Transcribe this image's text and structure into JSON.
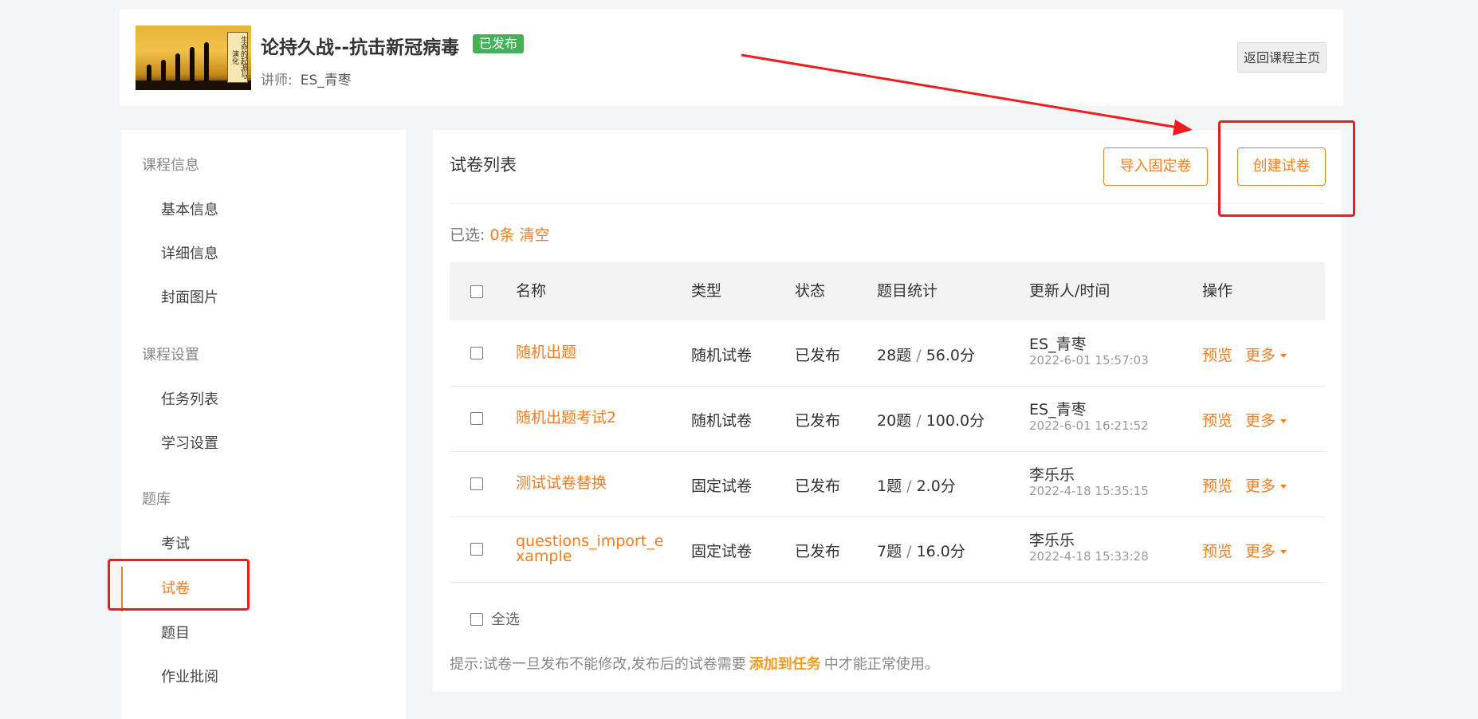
{
  "header": {
    "title": "论持久战--抗击新冠病毒",
    "badge": "已发布",
    "teacher_label": "讲师:",
    "teacher_name": "ES_青枣",
    "back_button": "返回课程主页",
    "thumbnail_text": "生命的起源与演化"
  },
  "sidebar": {
    "groups": [
      {
        "label": "课程信息",
        "items": [
          "基本信息",
          "详细信息",
          "封面图片"
        ]
      },
      {
        "label": "课程设置",
        "items": [
          "任务列表",
          "学习设置"
        ]
      },
      {
        "label": "题库",
        "items": [
          "考试",
          "试卷",
          "题目",
          "作业批阅"
        ]
      }
    ],
    "active_item": "试卷"
  },
  "main": {
    "title": "试卷列表",
    "import_button": "导入固定卷",
    "create_button": "创建试卷",
    "selected_label": "已选:",
    "selected_count": "0条",
    "clear_label": "清空",
    "columns": [
      "名称",
      "类型",
      "状态",
      "题目统计",
      "更新人/时间",
      "操作"
    ],
    "rows": [
      {
        "name": "随机出题",
        "type": "随机试卷",
        "status": "已发布",
        "questions": "28题",
        "score": "56.0分",
        "user": "ES_青枣",
        "time": "2022-6-01 15:57:03"
      },
      {
        "name": "随机出题考试2",
        "type": "随机试卷",
        "status": "已发布",
        "questions": "20题",
        "score": "100.0分",
        "user": "ES_青枣",
        "time": "2022-6-01 16:21:52"
      },
      {
        "name": "测试试卷替换",
        "type": "固定试卷",
        "status": "已发布",
        "questions": "1题",
        "score": "2.0分",
        "user": "李乐乐",
        "time": "2022-4-18 15:35:15"
      },
      {
        "name": "questions_import_example",
        "type": "固定试卷",
        "status": "已发布",
        "questions": "7题",
        "score": "16.0分",
        "user": "李乐乐",
        "time": "2022-4-18 15:33:28"
      }
    ],
    "preview_label": "预览",
    "more_label": "更多",
    "select_all": "全选",
    "tip_prefix": "提示:试卷一旦发布不能修改,发布后的试卷需要",
    "tip_link": "添加到任务",
    "tip_suffix": "中才能正常使用。"
  },
  "colors": {
    "accent": "#f47c1f",
    "badge_green": "#46b05a",
    "annotation_red": "#ee1c1c"
  }
}
